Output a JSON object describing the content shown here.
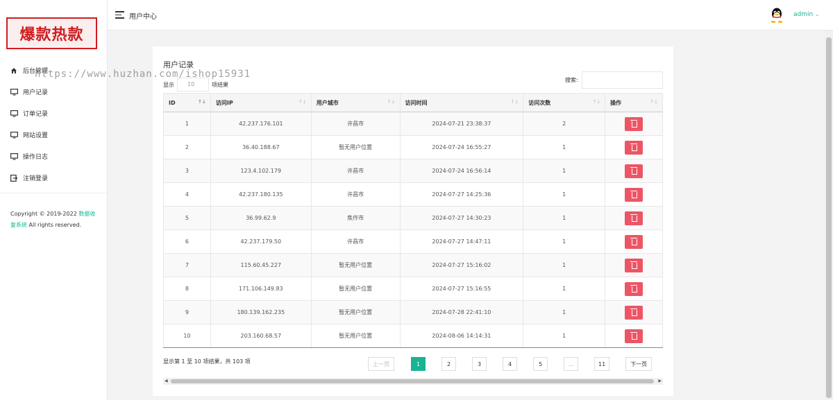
{
  "brand": {
    "logo_text": "爆款热款"
  },
  "sidebar": {
    "items": [
      {
        "label": "后台管理",
        "icon": "home-icon"
      },
      {
        "label": "用户记录",
        "icon": "monitor-icon"
      },
      {
        "label": "订单记录",
        "icon": "monitor-icon"
      },
      {
        "label": "网站设置",
        "icon": "monitor-icon"
      },
      {
        "label": "操作日志",
        "icon": "monitor-icon"
      },
      {
        "label": "注销登录",
        "icon": "logout-icon"
      }
    ],
    "copyright_prefix": "Copyright © 2019-2022 ",
    "copyright_link": "数据收复系统",
    "copyright_suffix": " All rights reserved."
  },
  "header": {
    "title": "用户中心",
    "user": "admin"
  },
  "watermark": "https://www.huzhan.com/ishop15931",
  "panel": {
    "title": "用户记录",
    "length_prefix": "显示",
    "length_value": "10",
    "length_suffix": "项结果",
    "search_label": "搜索:",
    "search_value": ""
  },
  "table": {
    "columns": [
      "ID",
      "访问IP",
      "用户城市",
      "访问时间",
      "访问次数",
      "操作"
    ],
    "rows": [
      {
        "id": "1",
        "ip": "42.237.176.101",
        "city": "许昌市",
        "time": "2024-07-21 23:38:37",
        "count": "2"
      },
      {
        "id": "2",
        "ip": "36.40.188.67",
        "city": "暂无用户位置",
        "time": "2024-07-24 16:55:27",
        "count": "1"
      },
      {
        "id": "3",
        "ip": "123.4.102.179",
        "city": "许昌市",
        "time": "2024-07-24 16:56:14",
        "count": "1"
      },
      {
        "id": "4",
        "ip": "42.237.180.135",
        "city": "许昌市",
        "time": "2024-07-27 14:25:36",
        "count": "1"
      },
      {
        "id": "5",
        "ip": "36.99.62.9",
        "city": "焦作市",
        "time": "2024-07-27 14:30:23",
        "count": "1"
      },
      {
        "id": "6",
        "ip": "42.237.179.50",
        "city": "许昌市",
        "time": "2024-07-27 14:47:11",
        "count": "1"
      },
      {
        "id": "7",
        "ip": "115.60.45.227",
        "city": "暂无用户位置",
        "time": "2024-07-27 15:16:02",
        "count": "1"
      },
      {
        "id": "8",
        "ip": "171.106.149.83",
        "city": "暂无用户位置",
        "time": "2024-07-27 15:16:55",
        "count": "1"
      },
      {
        "id": "9",
        "ip": "180.139.162.235",
        "city": "暂无用户位置",
        "time": "2024-07-28 22:41:10",
        "count": "1"
      },
      {
        "id": "10",
        "ip": "203.160.68.57",
        "city": "暂无用户位置",
        "time": "2024-08-06 14:14:31",
        "count": "1"
      }
    ]
  },
  "footer": {
    "info": "显示第 1 至 10 项结果，共 103 项",
    "pager": {
      "prev": "上一页",
      "pages": [
        "1",
        "2",
        "3",
        "4",
        "5",
        "…",
        "11"
      ],
      "next": "下一页",
      "current": "1"
    }
  },
  "colors": {
    "accent": "#1ab394",
    "danger": "#ed5565",
    "logo": "#d01c1f"
  }
}
